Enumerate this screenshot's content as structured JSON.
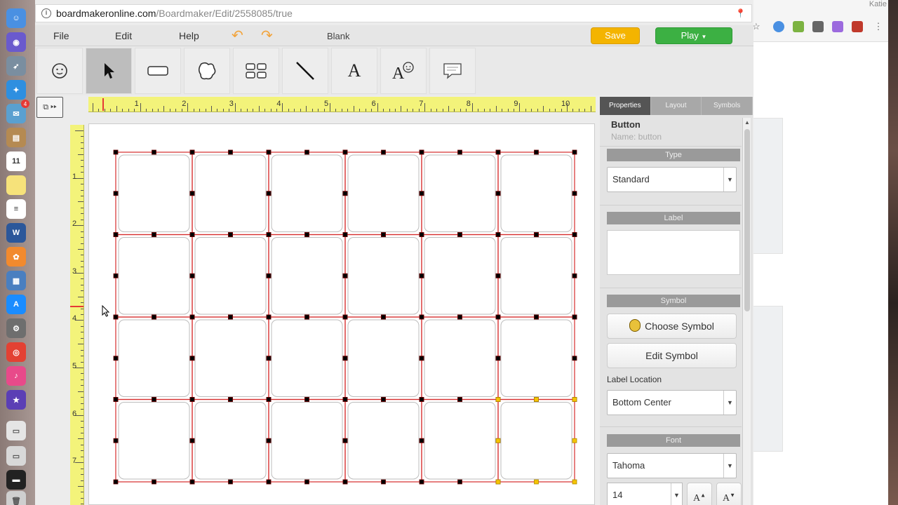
{
  "url": {
    "host": "boardmakeronline.com",
    "path": "/Boardmaker/Edit/2558085/true"
  },
  "menubar": {
    "file": "File",
    "edit": "Edit",
    "help": "Help",
    "doc_title": "Blank",
    "save": "Save",
    "play": "Play"
  },
  "tools": [
    "symbol-tool",
    "select-tool",
    "button-tool",
    "freeform-tool",
    "grid-tool",
    "line-tool",
    "text-tool",
    "symbolate-tool",
    "speech-bubble-tool"
  ],
  "ruler": {
    "h_labels": [
      "1",
      "2",
      "3",
      "4",
      "5",
      "6",
      "7",
      "8",
      "9",
      "10"
    ],
    "v_labels": [
      "1",
      "2",
      "3",
      "4",
      "5",
      "6",
      "7"
    ]
  },
  "grid": {
    "columns": 6,
    "rows": 4
  },
  "properties": {
    "tabs": [
      "Properties",
      "Layout",
      "Symbols"
    ],
    "active_tab": "Properties",
    "object_title": "Button",
    "object_name": "Name: button",
    "type_header": "Type",
    "type_value": "Standard",
    "label_header": "Label",
    "label_value": "",
    "symbol_header": "Symbol",
    "choose_symbol": "Choose Symbol",
    "edit_symbol": "Edit Symbol",
    "label_location_label": "Label Location",
    "label_location_value": "Bottom Center",
    "font_header": "Font",
    "font_value": "Tahoma",
    "font_size": "14"
  },
  "background_window": {
    "user": "Katie"
  },
  "colors": {
    "save": "#f4b400",
    "play": "#3cb043",
    "selection": "#d62b2b",
    "handle": "#000000",
    "handle_selected": "#f5c400",
    "ruler": "#f3f37a"
  }
}
